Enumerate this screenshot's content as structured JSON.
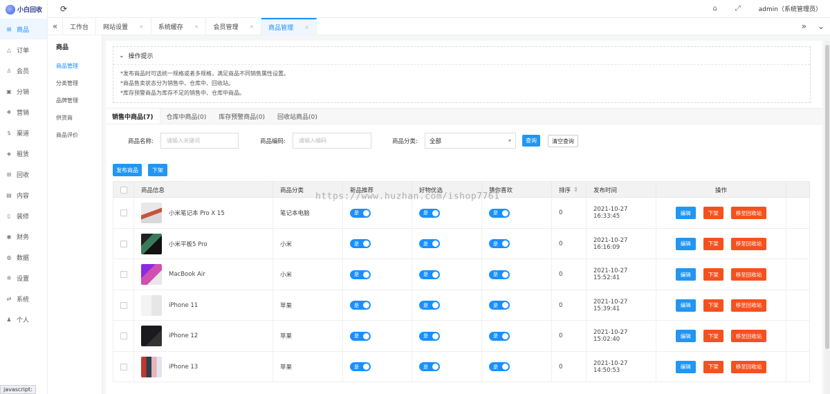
{
  "brand": {
    "name": "小白回收"
  },
  "sidebar": {
    "items": [
      {
        "label": "商品",
        "icon": "cart-icon",
        "glyph": "⊞"
      },
      {
        "label": "订单",
        "icon": "bell-icon",
        "glyph": "△"
      },
      {
        "label": "会员",
        "icon": "user-icon",
        "glyph": "♙"
      },
      {
        "label": "分销",
        "icon": "lock-icon",
        "glyph": "▣"
      },
      {
        "label": "营销",
        "icon": "gift-icon",
        "glyph": "❖"
      },
      {
        "label": "渠道",
        "icon": "dollar-icon",
        "glyph": "$"
      },
      {
        "label": "租赁",
        "icon": "shield-icon",
        "glyph": "◈"
      },
      {
        "label": "回收",
        "icon": "cart-icon",
        "glyph": "⊞"
      },
      {
        "label": "内容",
        "icon": "book-icon",
        "glyph": "▤"
      },
      {
        "label": "装修",
        "icon": "phone-icon",
        "glyph": "▯"
      },
      {
        "label": "财务",
        "icon": "coin-icon",
        "glyph": "◉"
      },
      {
        "label": "数据",
        "icon": "data-icon",
        "glyph": "◍"
      },
      {
        "label": "设置",
        "icon": "gear-icon",
        "glyph": "✲"
      },
      {
        "label": "系统",
        "icon": "shuffle-icon",
        "glyph": "⇄"
      },
      {
        "label": "个人",
        "icon": "person-icon",
        "glyph": "♟"
      }
    ]
  },
  "topbar": {
    "user": "admin（系统管理员）"
  },
  "tabs": [
    {
      "label": "工作台",
      "closable": false
    },
    {
      "label": "网站设置",
      "closable": true
    },
    {
      "label": "系统缓存",
      "closable": true
    },
    {
      "label": "会员管理",
      "closable": true
    },
    {
      "label": "商品管理",
      "closable": true
    }
  ],
  "subnav": {
    "title": "商品",
    "items": [
      "商品管理",
      "分类管理",
      "品牌管理",
      "供货商",
      "商品评价"
    ]
  },
  "tips": {
    "title": "操作提示",
    "lines": [
      "*发布商品时可选统一规格或者多规格，满足商品不同销售属性设置。",
      "*商品售卖状态分为销售中、仓库中、回收站。",
      "*库存预警商品为库存不足的销售中、仓库中商品。"
    ]
  },
  "status_tabs": [
    "销售中商品(7)",
    "仓库中商品(0)",
    "库存预警商品(0)",
    "回收站商品(0)"
  ],
  "filters": {
    "name_label": "商品名称:",
    "name_placeholder": "请输入关键词",
    "code_label": "商品编码:",
    "code_placeholder": "请输入编码",
    "category_label": "商品分类:",
    "category_value": "全部",
    "search_button": "查询",
    "clear_button": "清空查询"
  },
  "actions": {
    "publish": "发布商品",
    "offline": "下架"
  },
  "table": {
    "headers": [
      "商品信息",
      "商品分类",
      "新品推荐",
      "好物优选",
      "猜你喜欢",
      "排序",
      "发布时间",
      "操作"
    ],
    "sort_icon": "sort-icon",
    "switch_label": "是",
    "ops": {
      "edit": "编辑",
      "offline": "下架",
      "recycle": "移至回收站"
    },
    "rows": [
      {
        "name": "小米笔记本 Pro X 15",
        "category": "笔记本电脑",
        "sort": "0",
        "time": "2021-10-27 16:33:45",
        "thumb": "laptop"
      },
      {
        "name": "小米平板5 Pro",
        "category": "小米",
        "sort": "0",
        "time": "2021-10-27 16:16:09",
        "thumb": "tablet"
      },
      {
        "name": "MacBook Air",
        "category": "小米",
        "sort": "0",
        "time": "2021-10-27 15:52:41",
        "thumb": "macbook"
      },
      {
        "name": "iPhone 11",
        "category": "苹果",
        "sort": "0",
        "time": "2021-10-27 15:39:41",
        "thumb": "iphone11"
      },
      {
        "name": "iPhone 12",
        "category": "苹果",
        "sort": "0",
        "time": "2021-10-27 15:02:40",
        "thumb": "iphone12"
      },
      {
        "name": "iPhone 13",
        "category": "苹果",
        "sort": "0",
        "time": "2021-10-27 14:50:53",
        "thumb": "iphone13"
      }
    ]
  },
  "watermark": "https://www.huzhan.com/ishop7761",
  "statusbar": "javascript:",
  "colors": {
    "accent": "#1890ff",
    "button_blue": "#2196f3",
    "button_red": "#f4511e"
  }
}
